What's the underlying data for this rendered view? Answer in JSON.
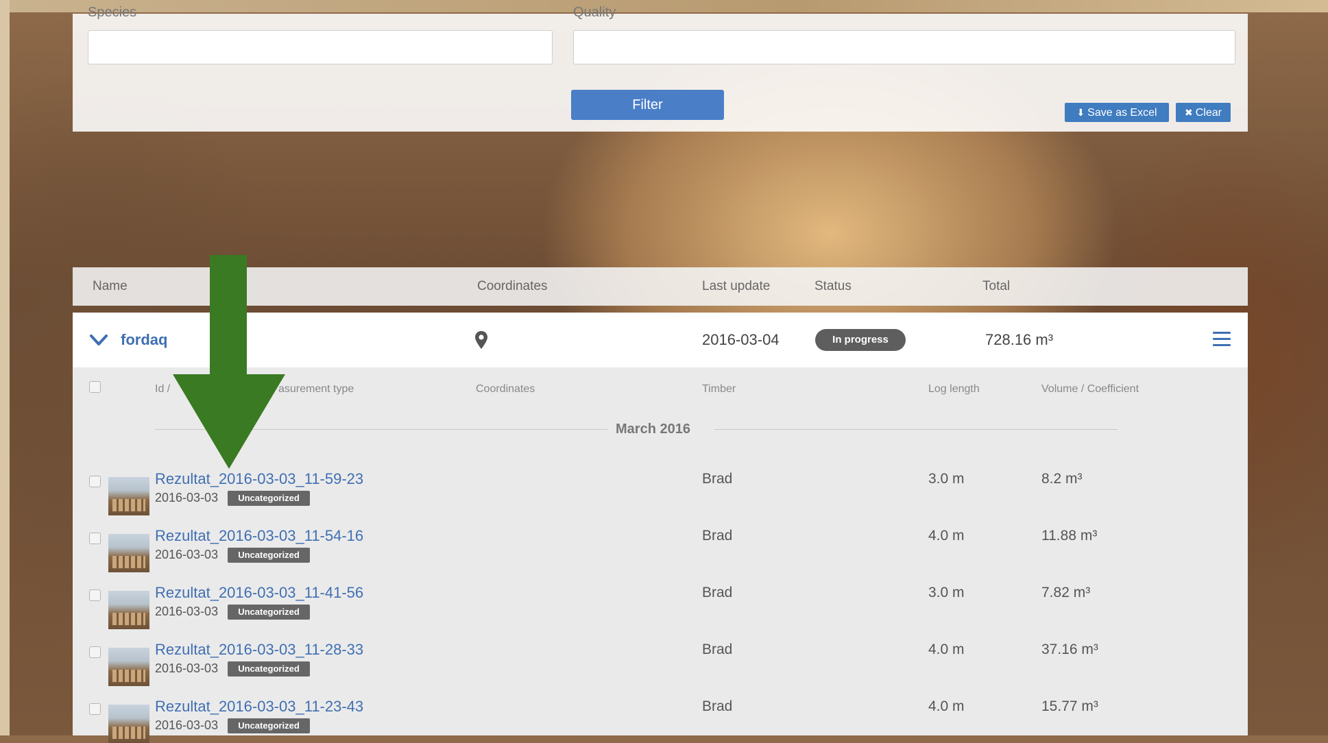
{
  "filter": {
    "species_label": "Species",
    "quality_label": "Quality",
    "species_value": "",
    "quality_value": "",
    "filter_button": "Filter",
    "save_excel_button": "Save as Excel",
    "clear_button": "Clear"
  },
  "table_header": {
    "name": "Name",
    "coordinates": "Coordinates",
    "last_update": "Last update",
    "status": "Status",
    "total": "Total"
  },
  "group": {
    "name": "fordaq",
    "last_update": "2016-03-04",
    "status": "In progress",
    "total": "728.16 m³"
  },
  "sub_header": {
    "id": "Id / Measurement type",
    "id_visible_left": "Id / ",
    "id_visible_right": "asurement type",
    "coordinates": "Coordinates",
    "timber": "Timber",
    "log_length": "Log length",
    "volume": "Volume / Coefficient"
  },
  "month_label": "March 2016",
  "rows": [
    {
      "name": "Rezultat_2016-03-03_11-59-23",
      "date": "2016-03-03",
      "badge": "Uncategorized",
      "timber": "Brad",
      "length": "3.0 m",
      "volume": "8.2 m³"
    },
    {
      "name": "Rezultat_2016-03-03_11-54-16",
      "date": "2016-03-03",
      "badge": "Uncategorized",
      "timber": "Brad",
      "length": "4.0 m",
      "volume": "11.88 m³"
    },
    {
      "name": "Rezultat_2016-03-03_11-41-56",
      "date": "2016-03-03",
      "badge": "Uncategorized",
      "timber": "Brad",
      "length": "3.0 m",
      "volume": "7.82 m³"
    },
    {
      "name": "Rezultat_2016-03-03_11-28-33",
      "date": "2016-03-03",
      "badge": "Uncategorized",
      "timber": "Brad",
      "length": "4.0 m",
      "volume": "37.16 m³"
    },
    {
      "name": "Rezultat_2016-03-03_11-23-43",
      "date": "2016-03-03",
      "badge": "Uncategorized",
      "timber": "Brad",
      "length": "4.0 m",
      "volume": "15.77 m³"
    }
  ],
  "colors": {
    "accent_blue": "#4a7fc8",
    "link_blue": "#3f6fb2",
    "arrow_green": "#3a7a22",
    "status_grey": "#5e5e5e"
  },
  "icons": {
    "chevron": "chevron-down-icon",
    "pin": "map-pin-icon",
    "menu": "hamburger-menu-icon",
    "download": "download-icon",
    "clear": "x-icon",
    "arrow": "down-arrow-icon"
  }
}
